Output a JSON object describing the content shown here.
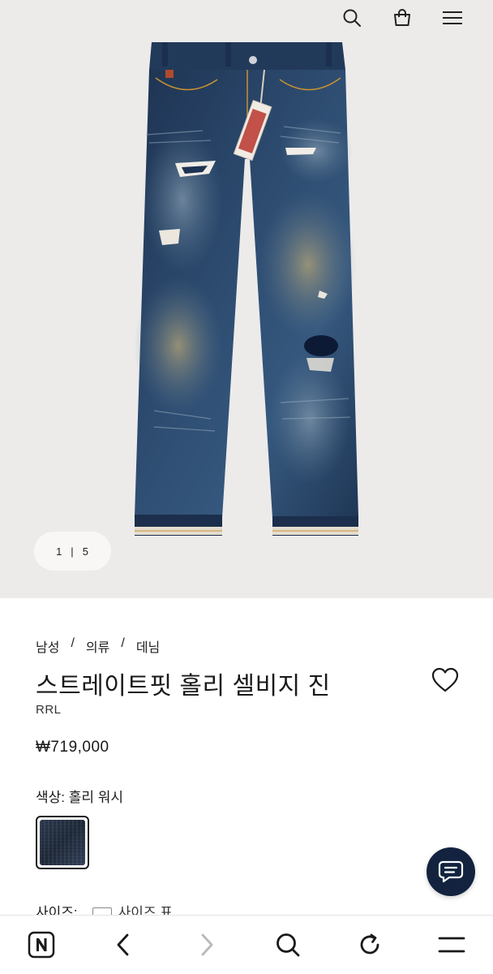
{
  "gallery": {
    "current": "1",
    "separator": "|",
    "total": "5"
  },
  "header_icons": [
    "search-icon",
    "shopping-bag-icon",
    "menu-icon"
  ],
  "breadcrumb": {
    "items": [
      "남성",
      "의류",
      "데님"
    ],
    "separator": "/"
  },
  "product": {
    "title": "스트레이트핏 홀리 셀비지 진",
    "brand": "RRL",
    "price": "₩719,000",
    "color_label": "색상: 홀리 워시",
    "size_label": "사이즈:",
    "size_guide_label": "사이즈 표"
  },
  "colors": {
    "hero_bg": "#ecebea",
    "chat_button": "#13233f",
    "text": "#1a1a1a"
  },
  "browser_bar": {
    "icons": [
      "naver-home-icon",
      "back-arrow-icon",
      "forward-arrow-icon",
      "search-icon",
      "refresh-icon",
      "menu-icon"
    ]
  }
}
